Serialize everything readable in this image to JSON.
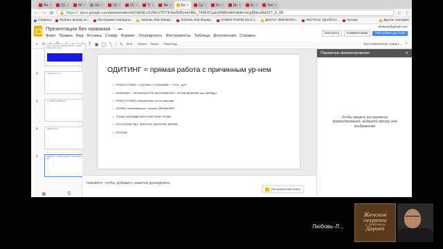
{
  "browser": {
    "tabs": [
      {
        "label": "Ви",
        "favicon": "youtube-icon",
        "active": false
      },
      {
        "label": "(2)",
        "favicon": "youtube-icon",
        "active": false
      },
      {
        "label": "Mi",
        "favicon": "youtube-icon",
        "active": false
      },
      {
        "label": "Gri",
        "favicon": "page-icon",
        "active": false
      },
      {
        "label": "(2)",
        "favicon": "youtube-icon",
        "active": false
      },
      {
        "label": "(2)",
        "favicon": "youtube-icon",
        "active": false
      },
      {
        "label": "Tr",
        "favicon": "youtube-icon",
        "active": false
      },
      {
        "label": "Ви",
        "favicon": "youtube-icon",
        "active": false
      },
      {
        "label": "Бе",
        "favicon": "slides-icon",
        "active": true
      },
      {
        "label": "Сд",
        "favicon": "youtube-icon",
        "active": false
      },
      {
        "label": "Ко",
        "favicon": "youtube-icon",
        "active": false
      },
      {
        "label": "Ди",
        "favicon": "youtube-icon",
        "active": false
      },
      {
        "label": "Ес",
        "favicon": "youtube-icon",
        "active": false
      },
      {
        "label": "Тре",
        "favicon": "youtube-icon",
        "active": false
      }
    ],
    "url_scheme": "https://",
    "url": "docs.google.com/presentation/d/1dtGEv2UWuV7OTK4ieZkRymrHBz_7495XCpdv0f9B/edit#slide=id.g389cd9d227_0_28",
    "bookmarks": [
      "Сервисы",
      "Любовь форму во...",
      "Программа передачи...",
      "Любовь-Лав Форму...",
      "Любовь-Лав Форму...",
      "ПАВЕЛ РАКОВ (Sv.C.)...",
      "ДИАНА ЛЕВЧЕНКО...",
      "Леи Ротаг (@arifzin)...",
      "Тренер",
      "Другие закладки"
    ]
  },
  "app": {
    "title": "Презентация без названия",
    "menu": [
      "Файл",
      "Правка",
      "Вид",
      "Вставка",
      "Слайд",
      "Формат",
      "Упорядочить",
      "Инструменты",
      "Таблица",
      "Дополнения",
      "Справка"
    ],
    "save_status": "Все изменения сохран...",
    "user_email": "dedose@gmail.com",
    "present_label": "Смотреть",
    "comments_label": "Комментарии",
    "share_label": "Настройки доступа",
    "toolbar": {
      "background_label": "Фон...",
      "layout_label": "Макет",
      "theme_label": "Тема...",
      "transition_label": "Переход..."
    }
  },
  "filmstrip": {
    "slides": [
      {
        "number": "",
        "text": "Третье понятие-создание Одитинг - диалог невидимого к Кост"
      },
      {
        "number": "2",
        "text": "• Конкретно: что •"
      },
      {
        "number": "3",
        "text": "• 3. НЕСПОСОБНОСТЬ"
      },
      {
        "number": "4",
        "text": "• Диагностика"
      },
      {
        "number": "5",
        "text": "ОДИТИНГ = прямая работа с причинным ур-нем"
      }
    ]
  },
  "slide": {
    "title": "ОДИТИНГ = прямая работа с причинным ур-нем",
    "bullets": [
      "ПРИСУТСТВИЕ = СТАТИКА = СОЗНАНИЕ = ТЭТА - ДУХ",
      "КОНФЛИКТ = ПРОФИЧНОСТЬ ВОСПРИЯТИЯ = ПРОМЫШЛЕНИЕ или ЗАРЯДЫ",
      "ПРИСУТСТВИЕ с внутренним что-то-чувствие",
      "ОБЪЁМ, интенсивность, точность ВНИМАНИЯ",
      "ТОЧКИ НАБЛЮДЕНИЯ И ЖЕСТКИЕ ТОЧКИ",
      "ПРОСТРАНСТВО, ЭНЕРГИЯ, МАТЕРИЯ, ВРЕМЯ",
      "ПОТОКИ"
    ]
  },
  "notes": {
    "placeholder": "Нажмите, чтобы добавить заметки докладчика"
  },
  "explore": {
    "label": "Расширенный поиск"
  },
  "format_panel": {
    "title": "Параметры форматирования",
    "message": "Чтобы увидеть инструменты форматирования, выберите фигуру или изображение"
  },
  "overlay": {
    "caption": "Любовь-Л...",
    "logo_lines": [
      "Женские",
      "секреты",
      "с Любовью",
      "Дарьей"
    ]
  }
}
